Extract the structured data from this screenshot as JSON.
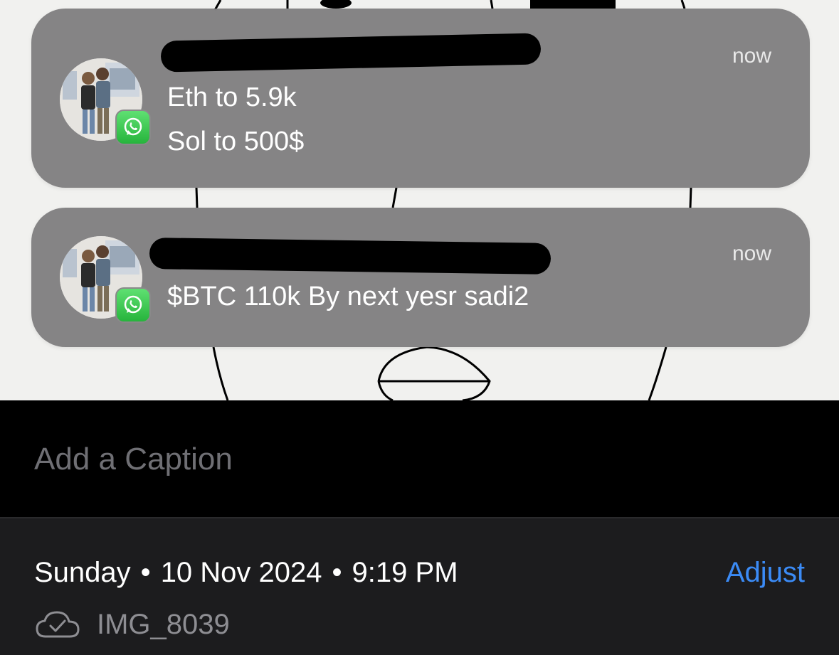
{
  "notifications": [
    {
      "app_icon": "whatsapp-icon",
      "time": "now",
      "lines": [
        "Eth to 5.9k",
        "Sol to 500$"
      ]
    },
    {
      "app_icon": "whatsapp-icon",
      "time": "now",
      "lines": [
        "$BTC 110k By next yesr sadi2"
      ]
    }
  ],
  "caption": {
    "placeholder": "Add a Caption"
  },
  "info": {
    "day": "Sunday",
    "date": "10 Nov 2024",
    "time": "9:19 PM",
    "separator": "•",
    "adjust_label": "Adjust",
    "file_icon": "icloud-check-icon",
    "file_name": "IMG_8039"
  },
  "colors": {
    "notification_bg": "#807f80",
    "whatsapp_green": "#2fc248",
    "accent_blue": "#3b8bf6",
    "panel_bg": "#1c1c1e"
  }
}
